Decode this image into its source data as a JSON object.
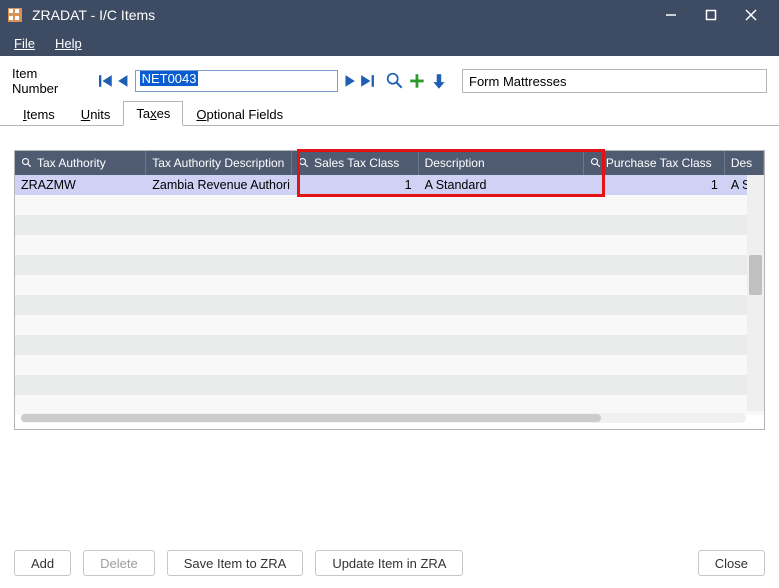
{
  "window": {
    "title": "ZRADAT - I/C Items"
  },
  "menu": {
    "file": "File",
    "help": "Help"
  },
  "form": {
    "item_label": "Item Number",
    "item_value": "NET0043",
    "desc_value": "Form Mattresses"
  },
  "tabs": {
    "items": "Items",
    "units": "Units",
    "taxes": "Taxes",
    "optional": "Optional Fields"
  },
  "grid": {
    "headers": {
      "tax_authority": "Tax Authority",
      "tax_authority_desc": "Tax Authority Description",
      "sales_tax_class": "Sales Tax Class",
      "description": "Description",
      "purchase_tax_class": "Purchase Tax Class",
      "desc2": "Des"
    },
    "rows": [
      {
        "tax_authority": "ZRAZMW",
        "tax_authority_desc": "Zambia Revenue Authori...",
        "sales_tax_class": "1",
        "description": "A Standard",
        "purchase_tax_class": "1",
        "desc2": "A St"
      }
    ]
  },
  "buttons": {
    "add": "Add",
    "delete": "Delete",
    "save_zra": "Save Item to ZRA",
    "update_zra": "Update Item in ZRA",
    "close": "Close"
  }
}
